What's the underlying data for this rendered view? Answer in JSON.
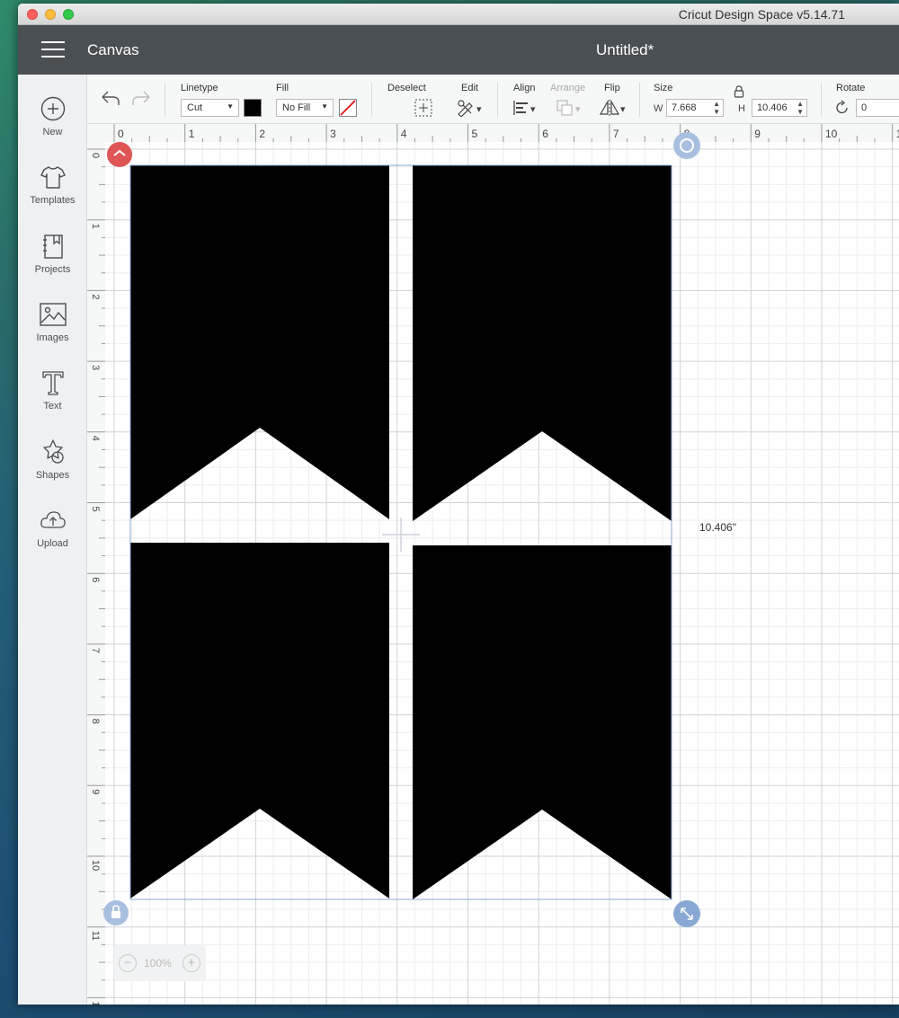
{
  "window": {
    "app_title": "Cricut Design Space  v5.14.71"
  },
  "header": {
    "section_label": "Canvas",
    "doc_title": "Untitled*"
  },
  "sidebar": {
    "items": [
      {
        "label": "New",
        "icon": "plus-circle-icon"
      },
      {
        "label": "Templates",
        "icon": "tshirt-icon"
      },
      {
        "label": "Projects",
        "icon": "projects-icon"
      },
      {
        "label": "Images",
        "icon": "image-icon"
      },
      {
        "label": "Text",
        "icon": "text-icon"
      },
      {
        "label": "Shapes",
        "icon": "shapes-icon"
      },
      {
        "label": "Upload",
        "icon": "cloud-upload-icon"
      }
    ]
  },
  "toolbar": {
    "linetype_label": "Linetype",
    "linetype_value": "Cut",
    "linetype_color": "#000000",
    "fill_label": "Fill",
    "fill_value": "No Fill",
    "deselect_label": "Deselect",
    "edit_label": "Edit",
    "align_label": "Align",
    "arrange_label": "Arrange",
    "flip_label": "Flip",
    "size_label": "Size",
    "width_prefix": "W",
    "width_value": "7.668",
    "height_prefix": "H",
    "height_value": "10.406",
    "rotate_label": "Rotate",
    "rotate_value": "0"
  },
  "canvas": {
    "ruler_top": [
      "0",
      "1",
      "2",
      "3",
      "4",
      "5",
      "6",
      "7",
      "8",
      "9",
      "10",
      "1"
    ],
    "ruler_left": [
      "0",
      "1",
      "2",
      "3",
      "4",
      "5",
      "6",
      "7",
      "8",
      "9",
      "10",
      "11",
      "12"
    ],
    "dimension_label": "10.406\"",
    "zoom_value": "100%",
    "shape_color": "#000000",
    "selection_color": "#89a8d4",
    "delete_handle_color": "#e05555"
  }
}
